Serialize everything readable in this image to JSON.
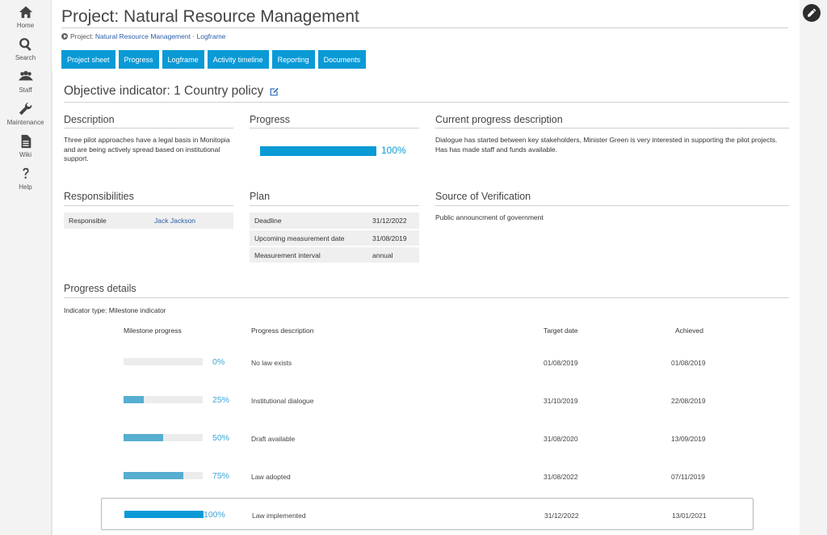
{
  "nav": [
    {
      "label": "Home",
      "icon": "home-icon"
    },
    {
      "label": "Search",
      "icon": "search-icon"
    },
    {
      "label": "Staff",
      "icon": "staff-icon"
    },
    {
      "label": "Maintenance",
      "icon": "wrench-icon"
    },
    {
      "label": "Wiki",
      "icon": "document-icon"
    },
    {
      "label": "Help",
      "icon": "question-icon"
    }
  ],
  "header": {
    "title": "Project: Natural Resource Management",
    "breadcrumb_prefix": "Project:",
    "breadcrumb_link": "Natural Resource Management · Logframe"
  },
  "tabs": [
    "Project sheet",
    "Progress",
    "Logframe",
    "Activity timeline",
    "Reporting",
    "Documents"
  ],
  "objective": {
    "title": "Objective indicator: 1 Country policy"
  },
  "description": {
    "heading": "Description",
    "text": "Three pilot approaches have a legal basis in Monitopia and are being actively spread based on institutional support."
  },
  "progress": {
    "heading": "Progress",
    "value": 1.0,
    "label": "100%"
  },
  "current_progress": {
    "heading": "Current progress description",
    "text": "Dialogue has started between key stakeholders, Minister Green is very interested in supporting the pilot projects. Has has made staff and funds available."
  },
  "responsibilities": {
    "heading": "Responsibilities",
    "label": "Responsible",
    "value": "Jack Jackson"
  },
  "plan": {
    "heading": "Plan",
    "rows": [
      {
        "label": "Deadline",
        "value": "31/12/2022"
      },
      {
        "label": "Upcoming measurement date",
        "value": "31/08/2019"
      },
      {
        "label": "Measurement interval",
        "value": "annual"
      }
    ]
  },
  "verification": {
    "heading": "Source of Verification",
    "text": "Public announcment of government"
  },
  "progress_details": {
    "heading": "Progress details",
    "indicator_type": "Indicator type: Milestone indicator",
    "columns": [
      "Milestone progress",
      "Progress description",
      "Target date",
      "Achieved"
    ],
    "rows": [
      {
        "progress": 0,
        "pct": "0%",
        "description": "No law exists",
        "target": "01/08/2019",
        "achieved": "01/08/2019"
      },
      {
        "progress": 0.25,
        "pct": "25%",
        "description": "Institutional dialogue",
        "target": "31/10/2019",
        "achieved": "22/08/2019"
      },
      {
        "progress": 0.5,
        "pct": "50%",
        "description": "Draft available",
        "target": "31/08/2020",
        "achieved": "13/09/2019"
      },
      {
        "progress": 0.75,
        "pct": "75%",
        "description": "Law adopted",
        "target": "31/08/2022",
        "achieved": "07/11/2019"
      },
      {
        "progress": 1.0,
        "pct": "100%",
        "description": "Law implemented",
        "target": "31/12/2022",
        "achieved": "13/01/2021"
      }
    ]
  },
  "colors": {
    "accent": "#0a9ad6",
    "link": "#2b5ea8",
    "milestone_fill": "#56aed0"
  }
}
